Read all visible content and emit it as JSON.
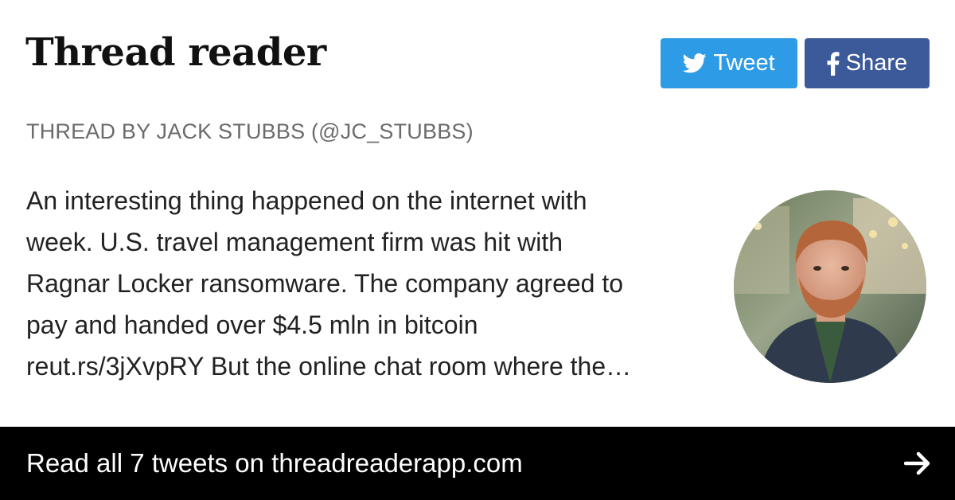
{
  "header": {
    "brand": "Thread reader",
    "tweet_label": "Tweet",
    "share_label": "Share"
  },
  "byline": "THREAD BY JACK STUBBS (@JC_STUBBS)",
  "excerpt": {
    "lines": [
      "An interesting thing happened on the internet with",
      "week. U.S. travel management firm was hit with",
      "Ragnar Locker ransomware. The company agreed to",
      "pay and handed over $4.5 mln in bitcoin",
      "reut.rs/3jXvpRY But the online chat room where the…"
    ]
  },
  "footer": {
    "cta": "Read all 7 tweets on threadreaderapp.com",
    "arrow_icon": "arrow-right-icon"
  },
  "colors": {
    "tweet_button": "#2d9be6",
    "share_button": "#3c5a99",
    "footer_bg": "#000000",
    "byline": "#6b6b6b"
  },
  "icons": {
    "tweet": "twitter-bird-icon",
    "share": "facebook-f-icon"
  }
}
